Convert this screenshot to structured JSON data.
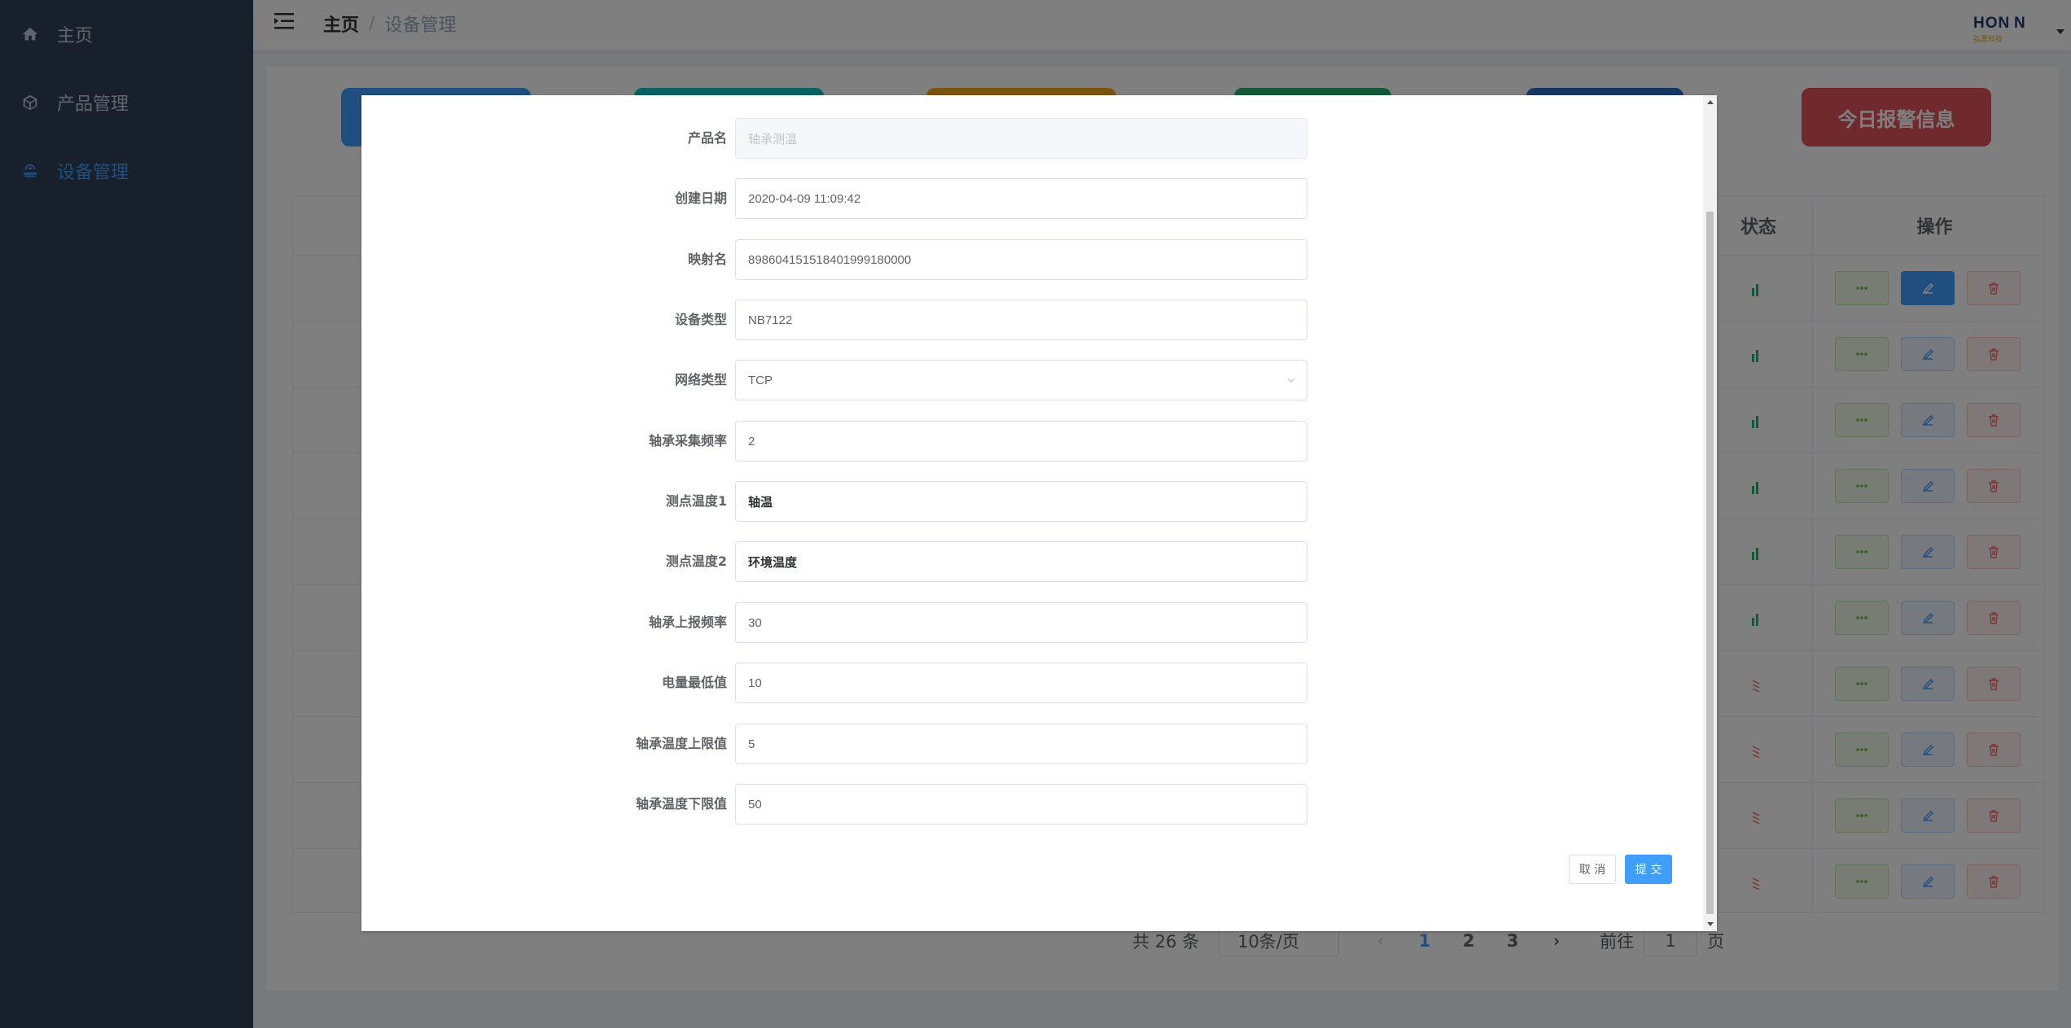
{
  "sidebar": {
    "items": [
      {
        "label": "主页",
        "icon": "home-icon"
      },
      {
        "label": "产品管理",
        "icon": "cube-icon"
      },
      {
        "label": "设备管理",
        "icon": "device-icon",
        "active": true
      }
    ]
  },
  "header": {
    "breadcrumb_home": "主页",
    "breadcrumb_sep": "/",
    "breadcrumb_current": "设备管理",
    "logo_text": "HON N",
    "logo_sub": "弘恩科技"
  },
  "stats": {
    "alarm_label": "今日报警信息"
  },
  "table": {
    "headers": {
      "status": "状态",
      "actions": "操作"
    }
  },
  "pagination": {
    "total": "共 26 条",
    "page_size": "10条/页",
    "pages": [
      "1",
      "2",
      "3"
    ],
    "current_page": "1",
    "goto_label": "前往",
    "goto_value": "1",
    "page_unit": "页"
  },
  "dialog": {
    "fields": [
      {
        "label": "产品名",
        "value": "轴承测温",
        "type": "disabled"
      },
      {
        "label": "创建日期",
        "value": "2020-04-09 11:09:42",
        "type": "text"
      },
      {
        "label": "映射名",
        "value": "89860415151840199918000\u00000",
        "type": "text"
      },
      {
        "label": "设备类型",
        "value": "NB7122",
        "type": "text"
      },
      {
        "label": "网络类型",
        "value": "TCP",
        "type": "select"
      },
      {
        "label": "轴承采集频率",
        "value": "2",
        "type": "text"
      },
      {
        "label": "测点温度1",
        "value": "轴温",
        "type": "bold"
      },
      {
        "label": "测点温度2",
        "value": "环境温度",
        "type": "bold"
      },
      {
        "label": "轴承上报频率",
        "value": "30",
        "type": "text"
      },
      {
        "label": "电量最低值",
        "value": "10",
        "type": "text"
      },
      {
        "label": "轴承温度上限值",
        "value": "5",
        "type": "text"
      },
      {
        "label": "轴承温度下限值",
        "value": "50",
        "type": "text"
      }
    ],
    "cancel_label": "取 消",
    "submit_label": "提 交"
  },
  "colors": {
    "sidebar_bg": "#304156",
    "accent": "#409eff",
    "alarm": "#e0545a"
  }
}
